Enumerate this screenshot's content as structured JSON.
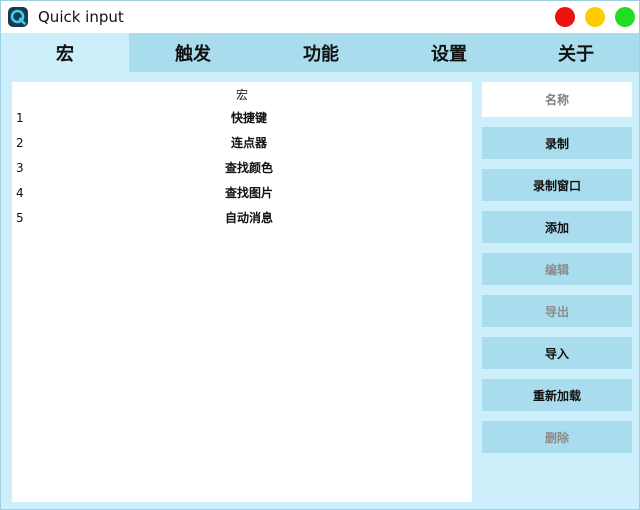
{
  "window": {
    "title": "Quick input",
    "icon": "q-logo-icon",
    "controls": {
      "close_color": "#ee1111",
      "minimize_color": "#ffcc00",
      "maximize_color": "#22dd22"
    }
  },
  "tabs": [
    {
      "label": "宏",
      "active": true
    },
    {
      "label": "触发",
      "active": false
    },
    {
      "label": "功能",
      "active": false
    },
    {
      "label": "设置",
      "active": false
    },
    {
      "label": "关于",
      "active": false
    }
  ],
  "macro_list": {
    "header": "宏",
    "rows": [
      {
        "index": "1",
        "name": "快捷键"
      },
      {
        "index": "2",
        "name": "连点器"
      },
      {
        "index": "3",
        "name": "查找颜色"
      },
      {
        "index": "4",
        "name": "查找图片"
      },
      {
        "index": "5",
        "name": "自动消息"
      }
    ]
  },
  "sidebar": {
    "name_placeholder": "名称",
    "buttons": [
      {
        "label": "录制",
        "enabled": true
      },
      {
        "label": "录制窗口",
        "enabled": true
      },
      {
        "label": "添加",
        "enabled": true
      },
      {
        "label": "编辑",
        "enabled": false
      },
      {
        "label": "导出",
        "enabled": false
      },
      {
        "label": "导入",
        "enabled": true
      },
      {
        "label": "重新加载",
        "enabled": true
      },
      {
        "label": "删除",
        "enabled": false
      }
    ]
  },
  "colors": {
    "window_bg": "#cdeefb",
    "tab_bar_bg": "#a9ddee",
    "button_bg": "#a9ddee",
    "disabled_text": "#8c8c8c"
  }
}
